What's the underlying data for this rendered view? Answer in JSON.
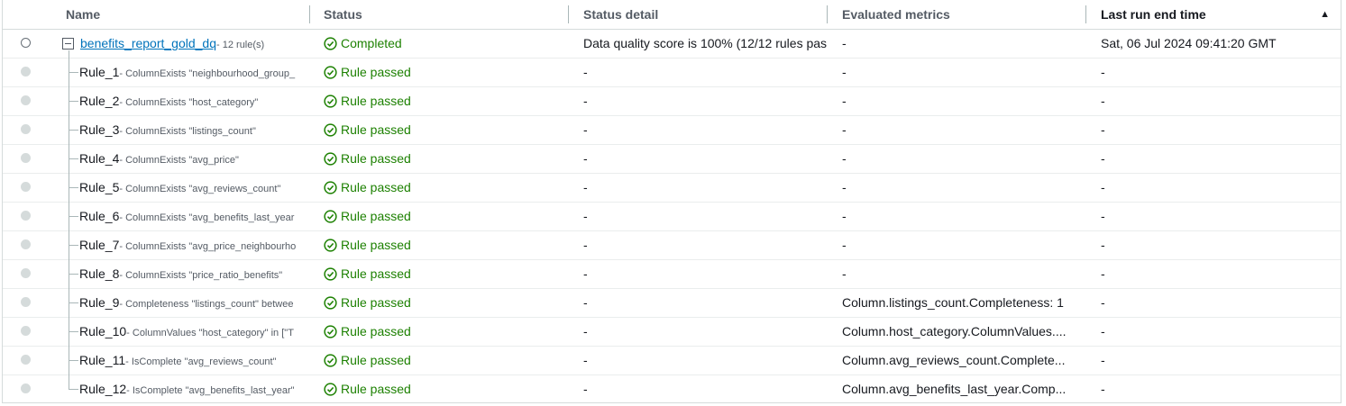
{
  "columns": {
    "name": "Name",
    "status": "Status",
    "status_detail": "Status detail",
    "evaluated_metrics": "Evaluated metrics",
    "last_run_end_time": "Last run end time"
  },
  "sort": {
    "column": "Last run end time",
    "direction": "ascending",
    "icon": "caret-up-icon"
  },
  "colors": {
    "link": "#0073bb",
    "success": "#1d8102",
    "header_text": "#545b64",
    "border": "#d5dbdb"
  },
  "parent": {
    "name": "benefits_report_gold_dq",
    "suffix": "- 12 rule(s)",
    "status": "Completed",
    "status_detail": "Data quality score is 100% (12/12 rules pas",
    "evaluated_metrics": "-",
    "last_run_end_time": "Sat, 06 Jul 2024 09:41:20 GMT"
  },
  "rules": [
    {
      "name": "Rule_1",
      "desc": "- ColumnExists \"neighbourhood_group_",
      "status": "Rule passed",
      "detail": "-",
      "metrics": "-",
      "last_run": "-"
    },
    {
      "name": "Rule_2",
      "desc": "- ColumnExists \"host_category\"",
      "status": "Rule passed",
      "detail": "-",
      "metrics": "-",
      "last_run": "-"
    },
    {
      "name": "Rule_3",
      "desc": "- ColumnExists \"listings_count\"",
      "status": "Rule passed",
      "detail": "-",
      "metrics": "-",
      "last_run": "-"
    },
    {
      "name": "Rule_4",
      "desc": "- ColumnExists \"avg_price\"",
      "status": "Rule passed",
      "detail": "-",
      "metrics": "-",
      "last_run": "-"
    },
    {
      "name": "Rule_5",
      "desc": "- ColumnExists \"avg_reviews_count\"",
      "status": "Rule passed",
      "detail": "-",
      "metrics": "-",
      "last_run": "-"
    },
    {
      "name": "Rule_6",
      "desc": "- ColumnExists \"avg_benefits_last_year",
      "status": "Rule passed",
      "detail": "-",
      "metrics": "-",
      "last_run": "-"
    },
    {
      "name": "Rule_7",
      "desc": "- ColumnExists \"avg_price_neighbourho",
      "status": "Rule passed",
      "detail": "-",
      "metrics": "-",
      "last_run": "-"
    },
    {
      "name": "Rule_8",
      "desc": "- ColumnExists \"price_ratio_benefits\"",
      "status": "Rule passed",
      "detail": "-",
      "metrics": "-",
      "last_run": "-"
    },
    {
      "name": "Rule_9",
      "desc": "- Completeness \"listings_count\" betwee",
      "status": "Rule passed",
      "detail": "-",
      "metrics": "Column.listings_count.Completeness: 1",
      "last_run": "-"
    },
    {
      "name": "Rule_10",
      "desc": "- ColumnValues \"host_category\" in [\"T",
      "status": "Rule passed",
      "detail": "-",
      "metrics": "Column.host_category.ColumnValues....",
      "last_run": "-"
    },
    {
      "name": "Rule_11",
      "desc": "- IsComplete \"avg_reviews_count\"",
      "status": "Rule passed",
      "detail": "-",
      "metrics": "Column.avg_reviews_count.Complete...",
      "last_run": "-"
    },
    {
      "name": "Rule_12",
      "desc": "- IsComplete \"avg_benefits_last_year\"",
      "status": "Rule passed",
      "detail": "-",
      "metrics": "Column.avg_benefits_last_year.Comp...",
      "last_run": "-"
    }
  ]
}
